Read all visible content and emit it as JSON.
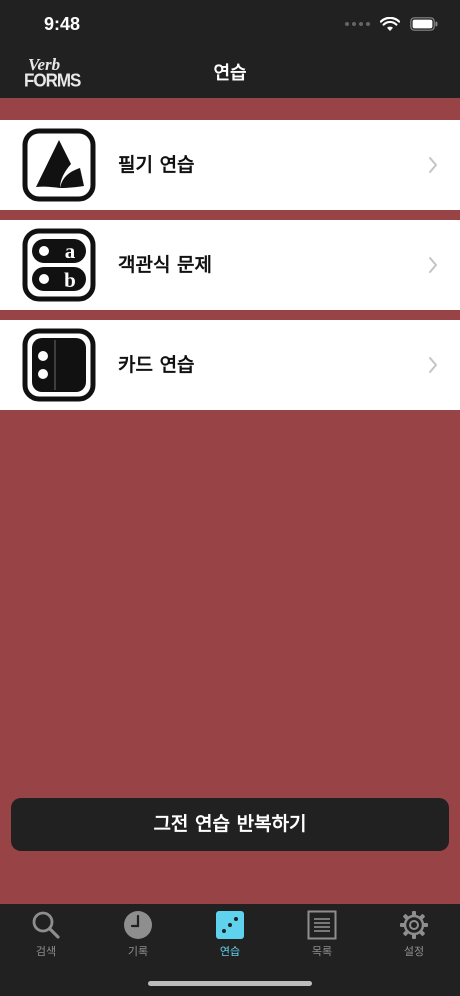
{
  "status_bar": {
    "time": "9:48"
  },
  "nav": {
    "logo_line1": "Verb",
    "logo_line2": "FORMS",
    "title": "연습"
  },
  "menu": [
    {
      "label": "필기 연습",
      "icon": "writing-icon"
    },
    {
      "label": "객관식 문제",
      "icon": "multiple-choice-icon"
    },
    {
      "label": "카드 연습",
      "icon": "flashcard-icon"
    }
  ],
  "repeat_button_label": "그전 연습 반복하기",
  "tabs": [
    {
      "label": "검색",
      "icon": "search-icon"
    },
    {
      "label": "기록",
      "icon": "clock-icon"
    },
    {
      "label": "연습",
      "icon": "dice-icon",
      "active": true
    },
    {
      "label": "목록",
      "icon": "list-icon"
    },
    {
      "label": "설정",
      "icon": "gear-icon"
    }
  ],
  "colors": {
    "background": "#984345",
    "bar": "#212121",
    "accent": "#5fd3ee"
  }
}
